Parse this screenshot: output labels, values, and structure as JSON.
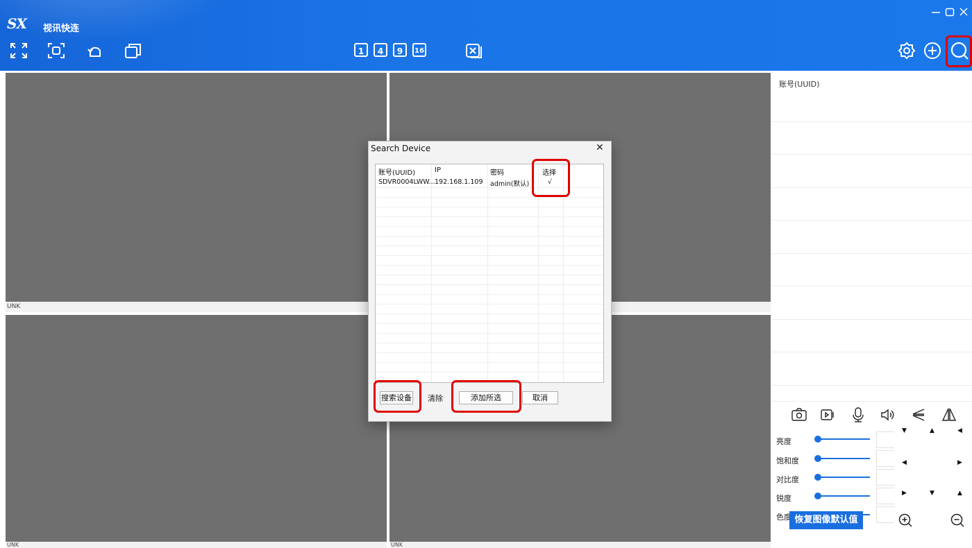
{
  "app": {
    "logo": "SX",
    "title": "视讯快连",
    "window_controls": [
      "minimize-icon",
      "maximize-icon",
      "close-icon"
    ]
  },
  "toolbar": {
    "left_icons": [
      "fullscreen-icon",
      "focus-frame-icon",
      "rotate-icon",
      "copy-window-icon"
    ],
    "layout_buttons": [
      "1",
      "4",
      "9",
      "16"
    ],
    "close_all_icon": "close-all-icon",
    "right_icons": [
      "settings-icon",
      "add-device-icon",
      "search-icon"
    ]
  },
  "video_panes": [
    {
      "label": "UNK"
    },
    {
      "label": ""
    },
    {
      "label": "UNK"
    },
    {
      "label": "UNK"
    }
  ],
  "right_panel": {
    "header": "账号(UUID)",
    "tools": [
      "snapshot-icon",
      "record-icon",
      "microphone-icon",
      "speaker-icon",
      "flip-vertical-icon",
      "mirror-icon"
    ],
    "sliders": [
      {
        "label": "亮度",
        "level": 0
      },
      {
        "label": "饱和度",
        "level": 0
      },
      {
        "label": "对比度",
        "level": 0
      },
      {
        "label": "锐度",
        "level": 0
      },
      {
        "label": "色度",
        "level": 0
      }
    ],
    "restore_button": "恢复图像默认值",
    "zoom_icons": [
      "zoom-in-icon",
      "zoom-out-icon"
    ]
  },
  "dialog": {
    "title": "Search Device",
    "columns": [
      "账号(UUID)",
      "IP",
      "密码",
      "选择"
    ],
    "rows": [
      {
        "uuid": "SDVR0004LWW...",
        "ip": "192.168.1.109",
        "password": "admin(默认)",
        "select": "√"
      }
    ],
    "buttons": {
      "search": "搜索设备",
      "clear": "清除",
      "add_selected": "添加所选",
      "cancel": "取消"
    }
  },
  "colors": {
    "title_bar": "#1a74e6",
    "accent": "#1a6fe0",
    "highlight": "#e00000",
    "video_bg": "#6f6f6f"
  }
}
